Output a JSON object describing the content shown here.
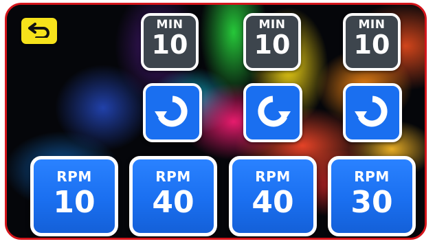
{
  "colors": {
    "frame_border": "#d4151b",
    "back_button": "#f6e21b",
    "min_tile": "#3d454d",
    "tile_blue": "#1a6ff0",
    "tile_border": "#ffffff"
  },
  "back_button": {
    "icon": "return-arrow-icon"
  },
  "timers": [
    {
      "label": "MIN",
      "value": "10"
    },
    {
      "label": "MIN",
      "value": "10"
    },
    {
      "label": "MIN",
      "value": "10"
    }
  ],
  "directions": [
    {
      "icon": "rotate-counterclockwise-icon"
    },
    {
      "icon": "rotate-clockwise-icon"
    },
    {
      "icon": "rotate-counterclockwise-icon"
    }
  ],
  "speeds": [
    {
      "label": "RPM",
      "value": "10"
    },
    {
      "label": "RPM",
      "value": "40"
    },
    {
      "label": "RPM",
      "value": "40"
    },
    {
      "label": "RPM",
      "value": "30"
    }
  ]
}
